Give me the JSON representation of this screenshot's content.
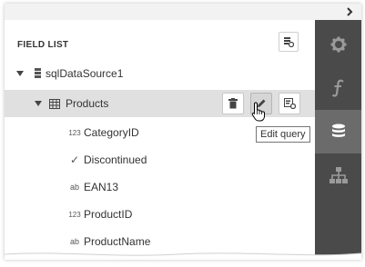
{
  "panel": {
    "title": "FIELD LIST"
  },
  "tree": {
    "datasource": {
      "label": "sqlDataSource1",
      "icon": "datasource-icon"
    },
    "table": {
      "label": "Products",
      "icon": "table-icon"
    },
    "fields": [
      {
        "type_label": "123",
        "name": "CategoryID",
        "type_icon": "number-type-icon"
      },
      {
        "type_label": "✓",
        "name": "Discontinued",
        "type_icon": "boolean-type-icon"
      },
      {
        "type_label": "ab",
        "name": "EAN13",
        "type_icon": "string-type-icon"
      },
      {
        "type_label": "123",
        "name": "ProductID",
        "type_icon": "number-type-icon"
      },
      {
        "type_label": "ab",
        "name": "ProductName",
        "type_icon": "string-type-icon"
      }
    ]
  },
  "tooltip": {
    "text": "Edit query"
  },
  "sidebar": {
    "items": [
      {
        "icon": "gear-icon",
        "active": false
      },
      {
        "icon": "function-icon",
        "active": false
      },
      {
        "icon": "database-icon",
        "active": true
      },
      {
        "icon": "hierarchy-icon",
        "active": false
      }
    ]
  },
  "colors": {
    "sidebar_bg": "#4a4a4a",
    "sidebar_active": "#6b6b6b",
    "selected_row": "#e0e0e0"
  }
}
